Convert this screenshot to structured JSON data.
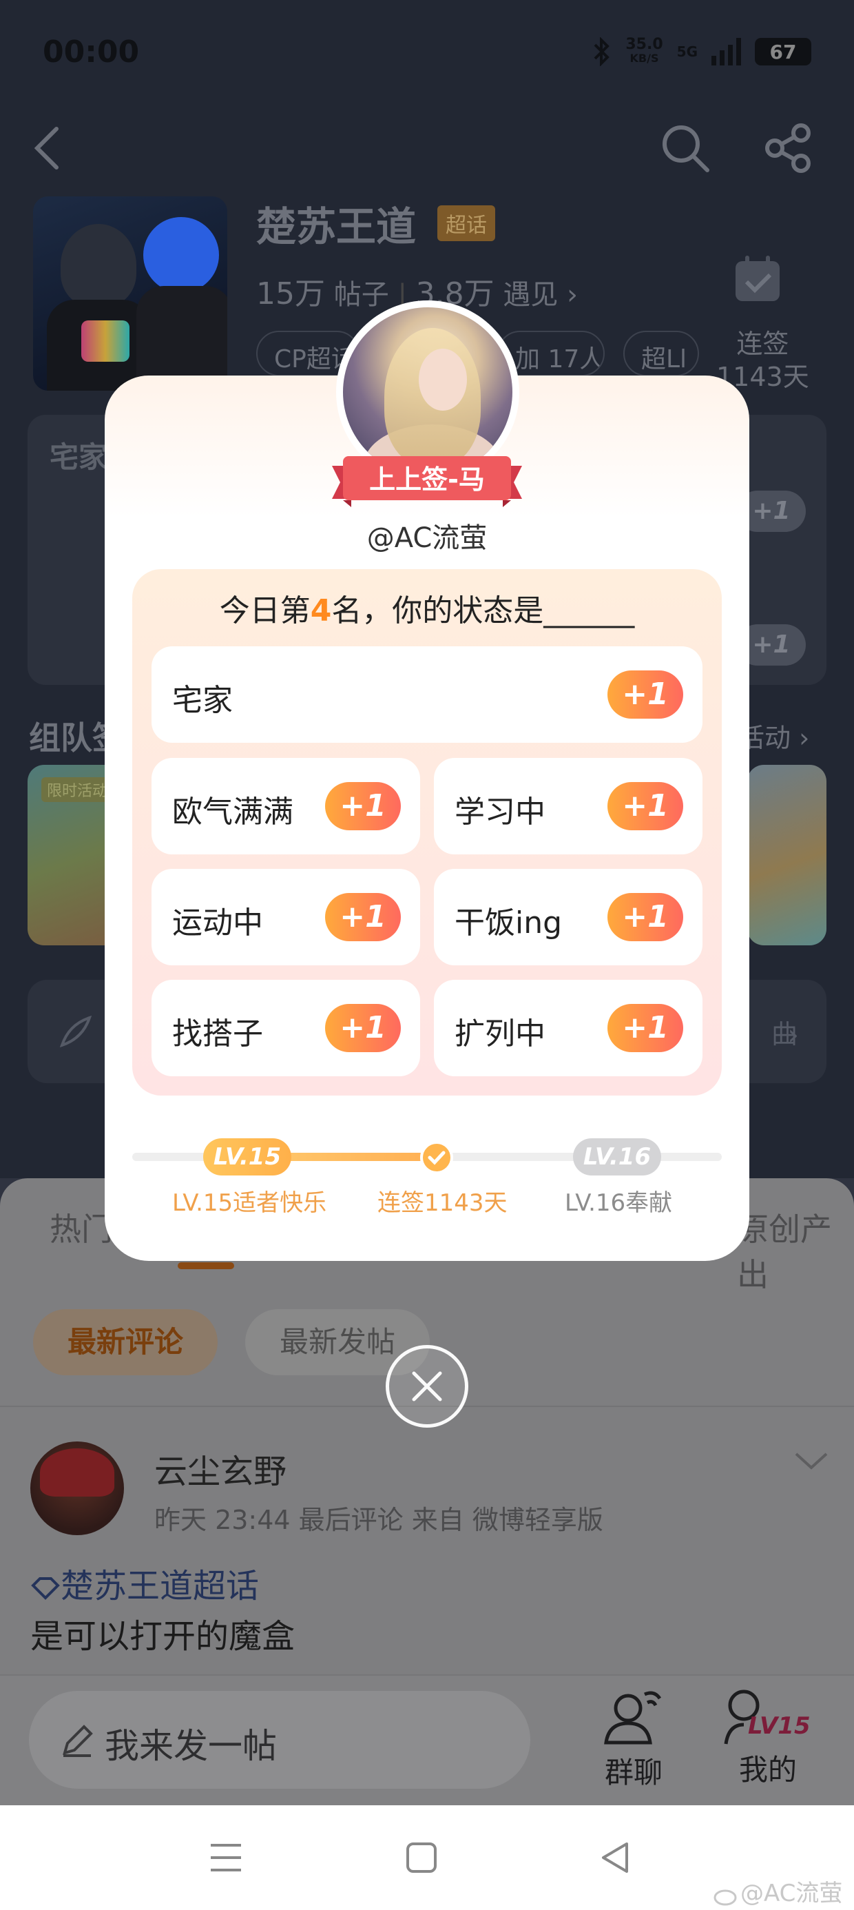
{
  "status_bar": {
    "time": "00:00",
    "net_speed": "35.0",
    "net_unit": "KB/S",
    "network": "5G",
    "battery": "67"
  },
  "topic": {
    "title": "楚苏王道",
    "badge": "超话",
    "posts_count": "15万",
    "posts_label": "帖子",
    "meet_count": "3.8万",
    "meet_label": "遇见",
    "chip_1": "CP超话",
    "chip_2": "加 17人",
    "chip_3": "超Ll",
    "checkin_label": "连签",
    "checkin_days": "1143天"
  },
  "background_sections": {
    "zhaijia": "宅家",
    "plus": "+1",
    "team_title": "组队签",
    "activity_link": "活动",
    "promo_tag": "限时活动",
    "post_entry_right": "曲"
  },
  "modal": {
    "fortune_ribbon": "上上签-马",
    "username": "@AC流萤",
    "question_prefix": "今日第",
    "rank": "4",
    "question_suffix": "名，你的状态是______",
    "plus_label": "+1",
    "options": [
      "宅家",
      "欧气满满",
      "学习中",
      "运动中",
      "干饭ing",
      "找搭子",
      "扩列中"
    ],
    "level": {
      "current_chip": "LV.15",
      "next_chip": "LV.16",
      "current_caption": "LV.15适者快乐",
      "streak_caption": "连签1143天",
      "next_caption": "LV.16奉献"
    }
  },
  "feed": {
    "tab_hot": "热门",
    "tab_original": "原创产出",
    "filter_active": "最新评论",
    "filter_inactive": "最新发帖",
    "author_name": "云尘玄野",
    "author_meta": "昨天 23:44 最后评论   来自 微博轻享版",
    "post_tag": "楚苏王道超话",
    "post_text": "是可以打开的魔盒"
  },
  "bottom_bar": {
    "write_post": "我来发一帖",
    "group_chat": "群聊",
    "mine": "我的",
    "mine_level": "LV15"
  },
  "watermark": "@AC流萤"
}
